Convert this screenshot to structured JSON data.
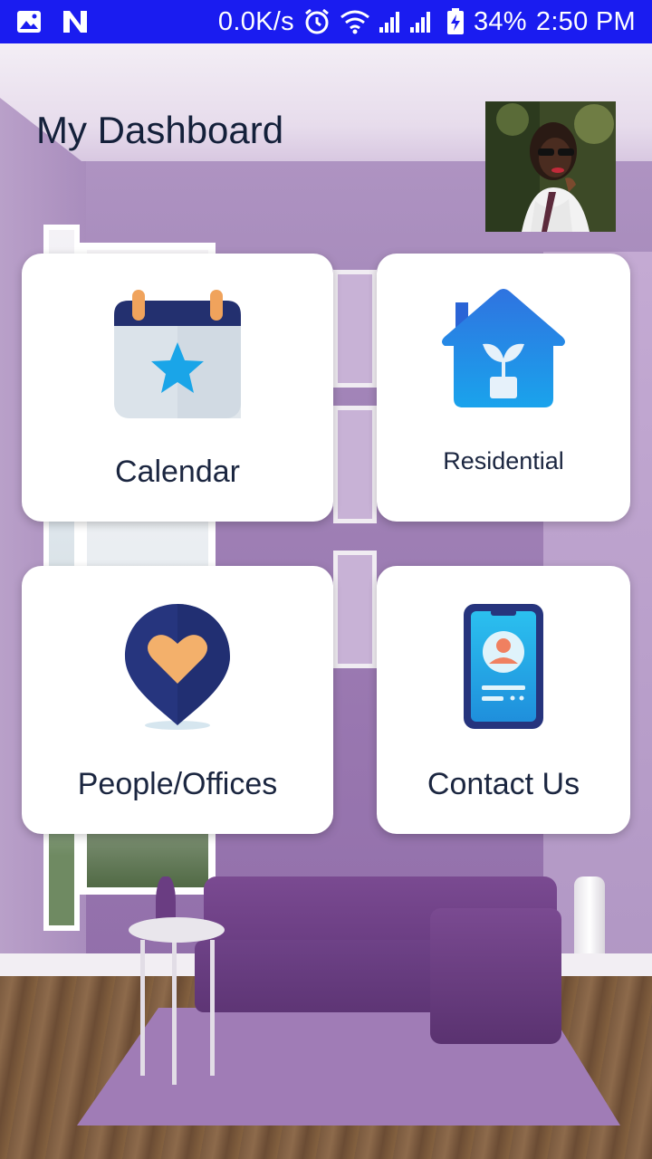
{
  "status_bar": {
    "network_speed": "0.0K/s",
    "battery_percent": "34%",
    "time": "2:50 PM",
    "icons": [
      "image-notification-icon",
      "n-notification-icon",
      "alarm-icon",
      "wifi-icon",
      "signal-icon",
      "battery-charging-icon"
    ]
  },
  "header": {
    "title": "My Dashboard"
  },
  "cards": [
    {
      "label": "Calendar",
      "icon": "calendar-star-icon"
    },
    {
      "label": "Residential",
      "icon": "house-plant-icon"
    },
    {
      "label": "People/Offices",
      "icon": "location-heart-icon"
    },
    {
      "label": "Contact Us",
      "icon": "phone-contact-icon"
    }
  ],
  "colors": {
    "status_bar": "#1a1cf0",
    "title_text": "#14203a",
    "card_bg": "#ffffff",
    "wall": "#a285b8"
  }
}
